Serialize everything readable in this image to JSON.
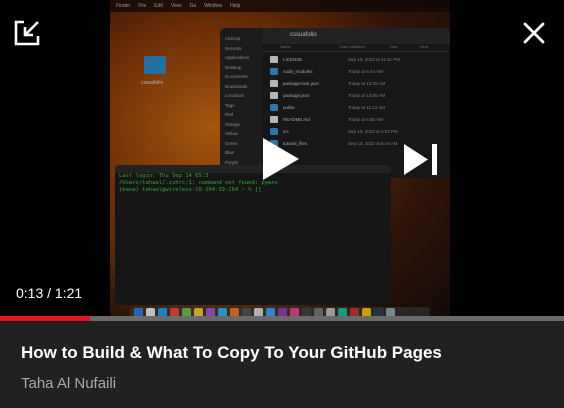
{
  "player": {
    "current_time": "0:13",
    "duration": "1:21",
    "time_separator": "/",
    "progress_fraction": 0.16,
    "accent_color": "#e0141e"
  },
  "controls": {
    "minimize_icon": "collapse-diagonal-icon",
    "close_icon": "close-icon",
    "play_icon": "play-icon",
    "next_icon": "skip-next-icon"
  },
  "video_frame": {
    "menubar_items": [
      "Finder",
      "File",
      "Edit",
      "View",
      "Go",
      "Window",
      "Help"
    ],
    "desktop_folder_label": "cssuafolio",
    "finder_title": "cssuafolio",
    "finder_headers": [
      "Name",
      "Date Modified",
      "Size",
      "Kind"
    ],
    "sidebar": [
      "AirDrop",
      "Recents",
      "Applications",
      "Desktop",
      "Documents",
      "Downloads",
      "Locations",
      "Tags",
      "Red",
      "Orange",
      "Yellow",
      "Green",
      "Blue",
      "Purple"
    ],
    "files": [
      {
        "name": "LICENSE",
        "date": "Sep 13, 2023 at 11:41 PM",
        "doc": true
      },
      {
        "name": "node_modules",
        "date": "Today at 6:44 AM",
        "doc": false
      },
      {
        "name": "package-lock.json",
        "date": "Today at 12:06 AM",
        "doc": true
      },
      {
        "name": "package.json",
        "date": "Today at 12:06 AM",
        "doc": true
      },
      {
        "name": "public",
        "date": "Today at 11:43 AM",
        "doc": false
      },
      {
        "name": "README.md",
        "date": "Today at 6:55 AM",
        "doc": true
      },
      {
        "name": "src",
        "date": "Sep 13, 2023 at 3:03 PM",
        "doc": false
      },
      {
        "name": "tutorial_files",
        "date": "Sep 13, 2023 at 6:19 AM",
        "doc": false
      }
    ],
    "terminal_lines": [
      "Last login: Thu Sep 14 05:3",
      "/Users/tahaal/.zshrc:1: command not found: pyenv",
      "(base) tahaal@wireless-10-104-39-264 ~ % []"
    ]
  },
  "video": {
    "title": "How to Build & What To Copy To Your GitHub Pages",
    "channel": "Taha Al Nufaili"
  }
}
